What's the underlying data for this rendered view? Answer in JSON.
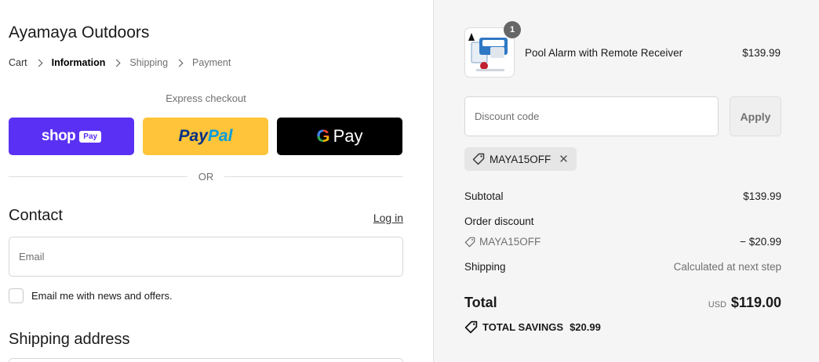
{
  "store": {
    "name": "Ayamaya Outdoors"
  },
  "breadcrumb": [
    {
      "label": "Cart"
    },
    {
      "label": "Information"
    },
    {
      "label": "Shipping"
    },
    {
      "label": "Payment"
    }
  ],
  "express": {
    "label": "Express checkout",
    "shop": {
      "word": "shop",
      "badge": "Pay"
    },
    "paypal": {
      "part1": "Pay",
      "part2": "Pal"
    },
    "gpay": {
      "g": "G",
      "word": "Pay"
    },
    "or": "OR"
  },
  "contact": {
    "title": "Contact",
    "login": "Log in",
    "email_placeholder": "Email",
    "newsletter_label": "Email me with news and offers."
  },
  "shipping": {
    "title": "Shipping address"
  },
  "order": {
    "product": {
      "name": "Pool Alarm with Remote Receiver",
      "price": "$139.99",
      "quantity": "1",
      "image_icon": "product-thumbnail"
    },
    "discount": {
      "placeholder": "Discount code",
      "apply_label": "Apply"
    },
    "applied_code": "MAYA15OFF",
    "subtotal_label": "Subtotal",
    "subtotal_value": "$139.99",
    "order_discount_label": "Order discount",
    "order_discount_code": "MAYA15OFF",
    "order_discount_value": "− $20.99",
    "shipping_label": "Shipping",
    "shipping_value": "Calculated at next step",
    "total_label": "Total",
    "total_currency": "USD",
    "total_value": "$119.00",
    "savings_label": "TOTAL SAVINGS",
    "savings_value": "$20.99"
  },
  "colors": {
    "shop_pay": "#5a31f4",
    "paypal": "#ffc439",
    "gpay": "#000000",
    "summary_bg": "#f5f5f5"
  }
}
